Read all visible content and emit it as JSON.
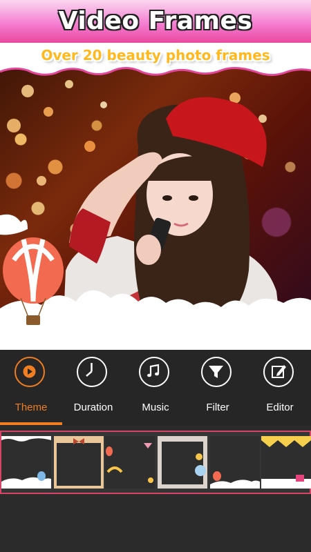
{
  "header": {
    "title": "Video Frames",
    "subtitle": "Over 20 beauty photo frames"
  },
  "toolbar": {
    "active": "Theme",
    "items": [
      {
        "label": "Theme",
        "icon": "play-circle-icon"
      },
      {
        "label": "Duration",
        "icon": "clock-icon"
      },
      {
        "label": "Music",
        "icon": "music-note-icon"
      },
      {
        "label": "Filter",
        "icon": "funnel-icon"
      },
      {
        "label": "Editor",
        "icon": "edit-icon"
      }
    ]
  },
  "frames": {
    "count_visible": 6,
    "items": [
      {
        "name": "cloud-balloon-frame"
      },
      {
        "name": "ribbon-border-frame"
      },
      {
        "name": "rainbow-balloon-frame"
      },
      {
        "name": "bear-balloon-frame"
      },
      {
        "name": "bunting-frame"
      },
      {
        "name": "party-frame"
      }
    ]
  },
  "colors": {
    "accent": "#f07e22",
    "strip_border": "#d64567",
    "header_pink": "#f47fd2",
    "subtitle_orange": "#ffb91e"
  }
}
